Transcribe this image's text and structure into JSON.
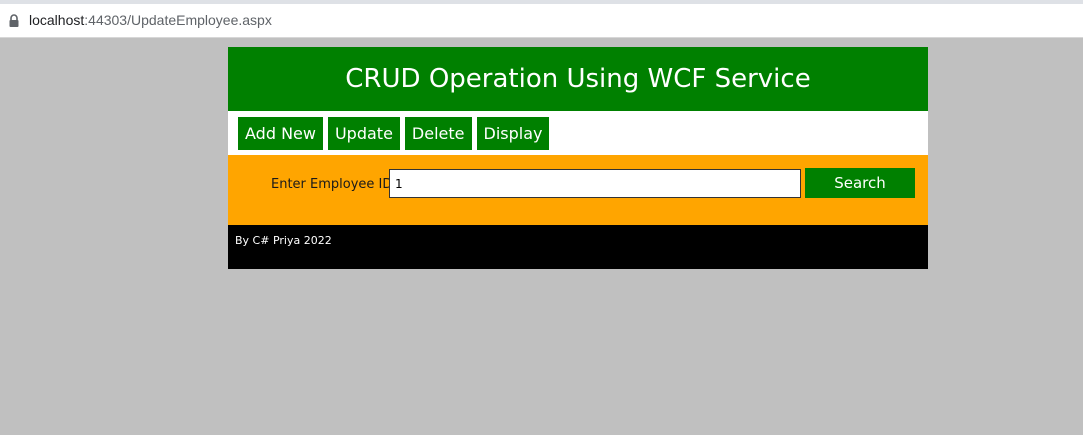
{
  "browser": {
    "url_host": "localhost",
    "url_path": ":44303/UpdateEmployee.aspx"
  },
  "header": {
    "title": "CRUD Operation Using WCF Service"
  },
  "menu": {
    "items": [
      {
        "label": "Add New"
      },
      {
        "label": "Update"
      },
      {
        "label": "Delete"
      },
      {
        "label": "Display"
      }
    ]
  },
  "search": {
    "label": "Enter Employee ID",
    "value": "1",
    "button_label": "Search"
  },
  "footer": {
    "text": "By C# Priya 2022"
  },
  "colors": {
    "header_bg": "#008000",
    "search_bg": "#ffa500",
    "footer_bg": "#000000",
    "page_bg": "#c0c0c0"
  },
  "icons": {
    "address_bar": "lock-icon"
  }
}
